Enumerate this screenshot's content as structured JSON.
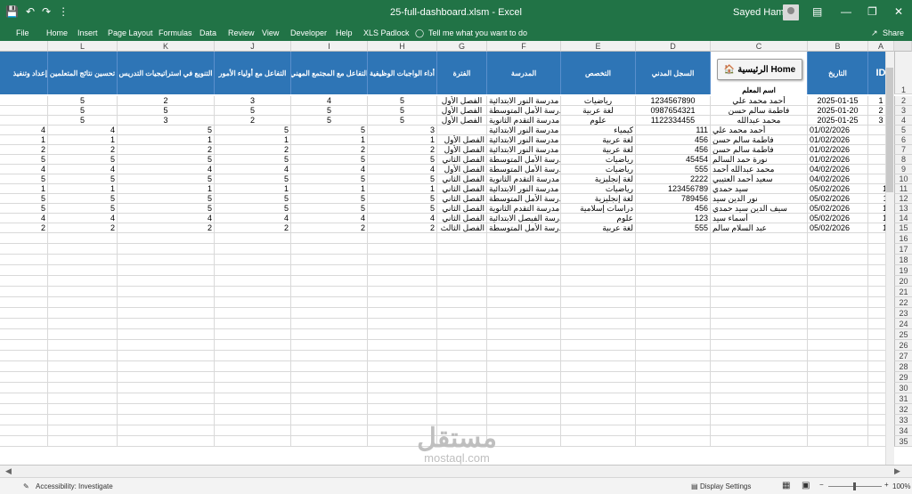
{
  "window": {
    "title": "25-full-dashboard.xlsm  -  Excel",
    "user": "Sayed Hamdy",
    "share": "Share"
  },
  "ribbon": {
    "tabs": [
      "File",
      "Home",
      "Insert",
      "Page Layout",
      "Formulas",
      "Data",
      "Review",
      "View",
      "Developer",
      "Help",
      "XLS Padlock"
    ],
    "tell_me": "Tell me what you want to do"
  },
  "columns": [
    "A",
    "B",
    "C",
    "D",
    "E",
    "F",
    "G",
    "H",
    "I",
    "J",
    "K",
    "L"
  ],
  "headers": {
    "A": "ID",
    "B": "التاريخ",
    "C": "اسم المعلم",
    "D": "السجل المدني",
    "E": "التخصص",
    "F": "المدرسة",
    "G": "الفترة",
    "H": "أداء الواجبات الوظيفية",
    "I": "التفاعل مع المجتمع المهني",
    "J": "التفاعل مع أولياء الأمور",
    "K": "التنويع في استراتيجيات التدريس",
    "L": "تحسين نتائج المتعلمين",
    "M": "إعداد وتنفيذ"
  },
  "home_button": "الرئيسية Home",
  "rows1": [
    {
      "id": "1",
      "date": "2025-01-15",
      "name": "أحمد محمد علي",
      "civil": "1234567890",
      "spec": "رياضيات",
      "school": "مدرسة النور الابتدائية",
      "period": "الفصل الأول",
      "h": "5",
      "i": "4",
      "j": "3",
      "k": "2",
      "l": "5"
    },
    {
      "id": "2",
      "date": "2025-01-20",
      "name": "فاطمة سالم حسن",
      "civil": "0987654321",
      "spec": "لغة عربية",
      "school": "مدرسة الأمل المتوسطة",
      "period": "الفصل الأول",
      "h": "5",
      "i": "5",
      "j": "5",
      "k": "5",
      "l": "5"
    },
    {
      "id": "3",
      "date": "2025-01-25",
      "name": "محمد عبدالله",
      "civil": "1122334455",
      "spec": "علوم",
      "school": "مدرسة التقدم الثانوية",
      "period": "الفصل الأول",
      "h": "5",
      "i": "5",
      "j": "2",
      "k": "3",
      "l": "5"
    }
  ],
  "rows2": [
    {
      "id": "4",
      "date": "01/02/2026",
      "name": "أحمد محمد علي",
      "civil": "111",
      "spec": "كيمياء",
      "school": "مدرسة النور الابتدائية",
      "period": "",
      "h": "3",
      "i": "5",
      "j": "5",
      "k": "5",
      "l": "4",
      "m": "4"
    },
    {
      "id": "5",
      "date": "01/02/2026",
      "name": "فاطمة سالم حسن",
      "civil": "456",
      "spec": "لغة عربية",
      "school": "مدرسة النور الابتدائية",
      "period": "الفصل الأول",
      "h": "1",
      "i": "1",
      "j": "1",
      "k": "1",
      "l": "1",
      "m": "1"
    },
    {
      "id": "6",
      "date": "01/02/2026",
      "name": "فاطمة سالم حسن",
      "civil": "456",
      "spec": "لغة عربية",
      "school": "مدرسة النور الابتدائية",
      "period": "الفصل الأول",
      "h": "2",
      "i": "2",
      "j": "2",
      "k": "2",
      "l": "2",
      "m": "2"
    },
    {
      "id": "7",
      "date": "01/02/2026",
      "name": "نورة حمد السالم",
      "civil": "45454",
      "spec": "رياضيات",
      "school": "مدرسة الأمل المتوسطة",
      "period": "الفصل الثاني",
      "h": "5",
      "i": "5",
      "j": "5",
      "k": "5",
      "l": "5",
      "m": "5"
    },
    {
      "id": "8",
      "date": "04/02/2026",
      "name": "محمد عبدالله أحمد",
      "civil": "555",
      "spec": "رياضيات",
      "school": "مدرسة الأمل المتوسطة",
      "period": "الفصل الأول",
      "h": "4",
      "i": "4",
      "j": "4",
      "k": "4",
      "l": "4",
      "m": "4"
    },
    {
      "id": "9",
      "date": "04/02/2026",
      "name": "سعيد أحمد العتيبي",
      "civil": "2222",
      "spec": "لغة إنجليزية",
      "school": "مدرسة التقدم الثانوية",
      "period": "الفصل الثاني",
      "h": "5",
      "i": "5",
      "j": "5",
      "k": "5",
      "l": "5",
      "m": "5"
    },
    {
      "id": "10",
      "date": "05/02/2026",
      "name": "سيد حمدي",
      "civil": "123456789",
      "spec": "رياضيات",
      "school": "مدرسة النور الابتدائية",
      "period": "الفصل الثاني",
      "h": "1",
      "i": "1",
      "j": "1",
      "k": "1",
      "l": "1",
      "m": "1"
    },
    {
      "id": "11",
      "date": "05/02/2026",
      "name": "نور الدين سيد",
      "civil": "789456",
      "spec": "لغة إنجليزية",
      "school": "مدرسة الأمل المتوسطة",
      "period": "الفصل الثاني",
      "h": "5",
      "i": "5",
      "j": "5",
      "k": "5",
      "l": "5",
      "m": "5"
    },
    {
      "id": "12",
      "date": "05/02/2026",
      "name": "سيف الدين سيد حمدي",
      "civil": "456",
      "spec": "دراسات إسلامية",
      "school": "مدرسة التقدم الثانوية",
      "period": "الفصل الثاني",
      "h": "5",
      "i": "5",
      "j": "5",
      "k": "5",
      "l": "5",
      "m": "5"
    },
    {
      "id": "13",
      "date": "05/02/2026",
      "name": "أسماء سيد",
      "civil": "123",
      "spec": "علوم",
      "school": "مدرسة الفيصل الابتدائية",
      "period": "الفصل الثاني",
      "h": "4",
      "i": "4",
      "j": "4",
      "k": "4",
      "l": "4",
      "m": "4"
    },
    {
      "id": "14",
      "date": "05/02/2026",
      "name": "عبد السلام سالم",
      "civil": "555",
      "spec": "لغة عربية",
      "school": "مدرسة الأمل المتوسطة",
      "period": "الفصل الثالث",
      "h": "2",
      "i": "2",
      "j": "2",
      "k": "2",
      "l": "2",
      "m": "2"
    }
  ],
  "empty_rows": [
    "16",
    "17",
    "18",
    "19",
    "20",
    "21",
    "22",
    "23",
    "24",
    "25",
    "26",
    "27",
    "28",
    "29",
    "30",
    "31",
    "32",
    "33",
    "34",
    "35"
  ],
  "status": {
    "accessibility": "Accessibility: Investigate",
    "display": "Display Settings",
    "zoom": "100%"
  },
  "watermark": {
    "arabic": "مستقل",
    "latin": "mostaql.com"
  }
}
